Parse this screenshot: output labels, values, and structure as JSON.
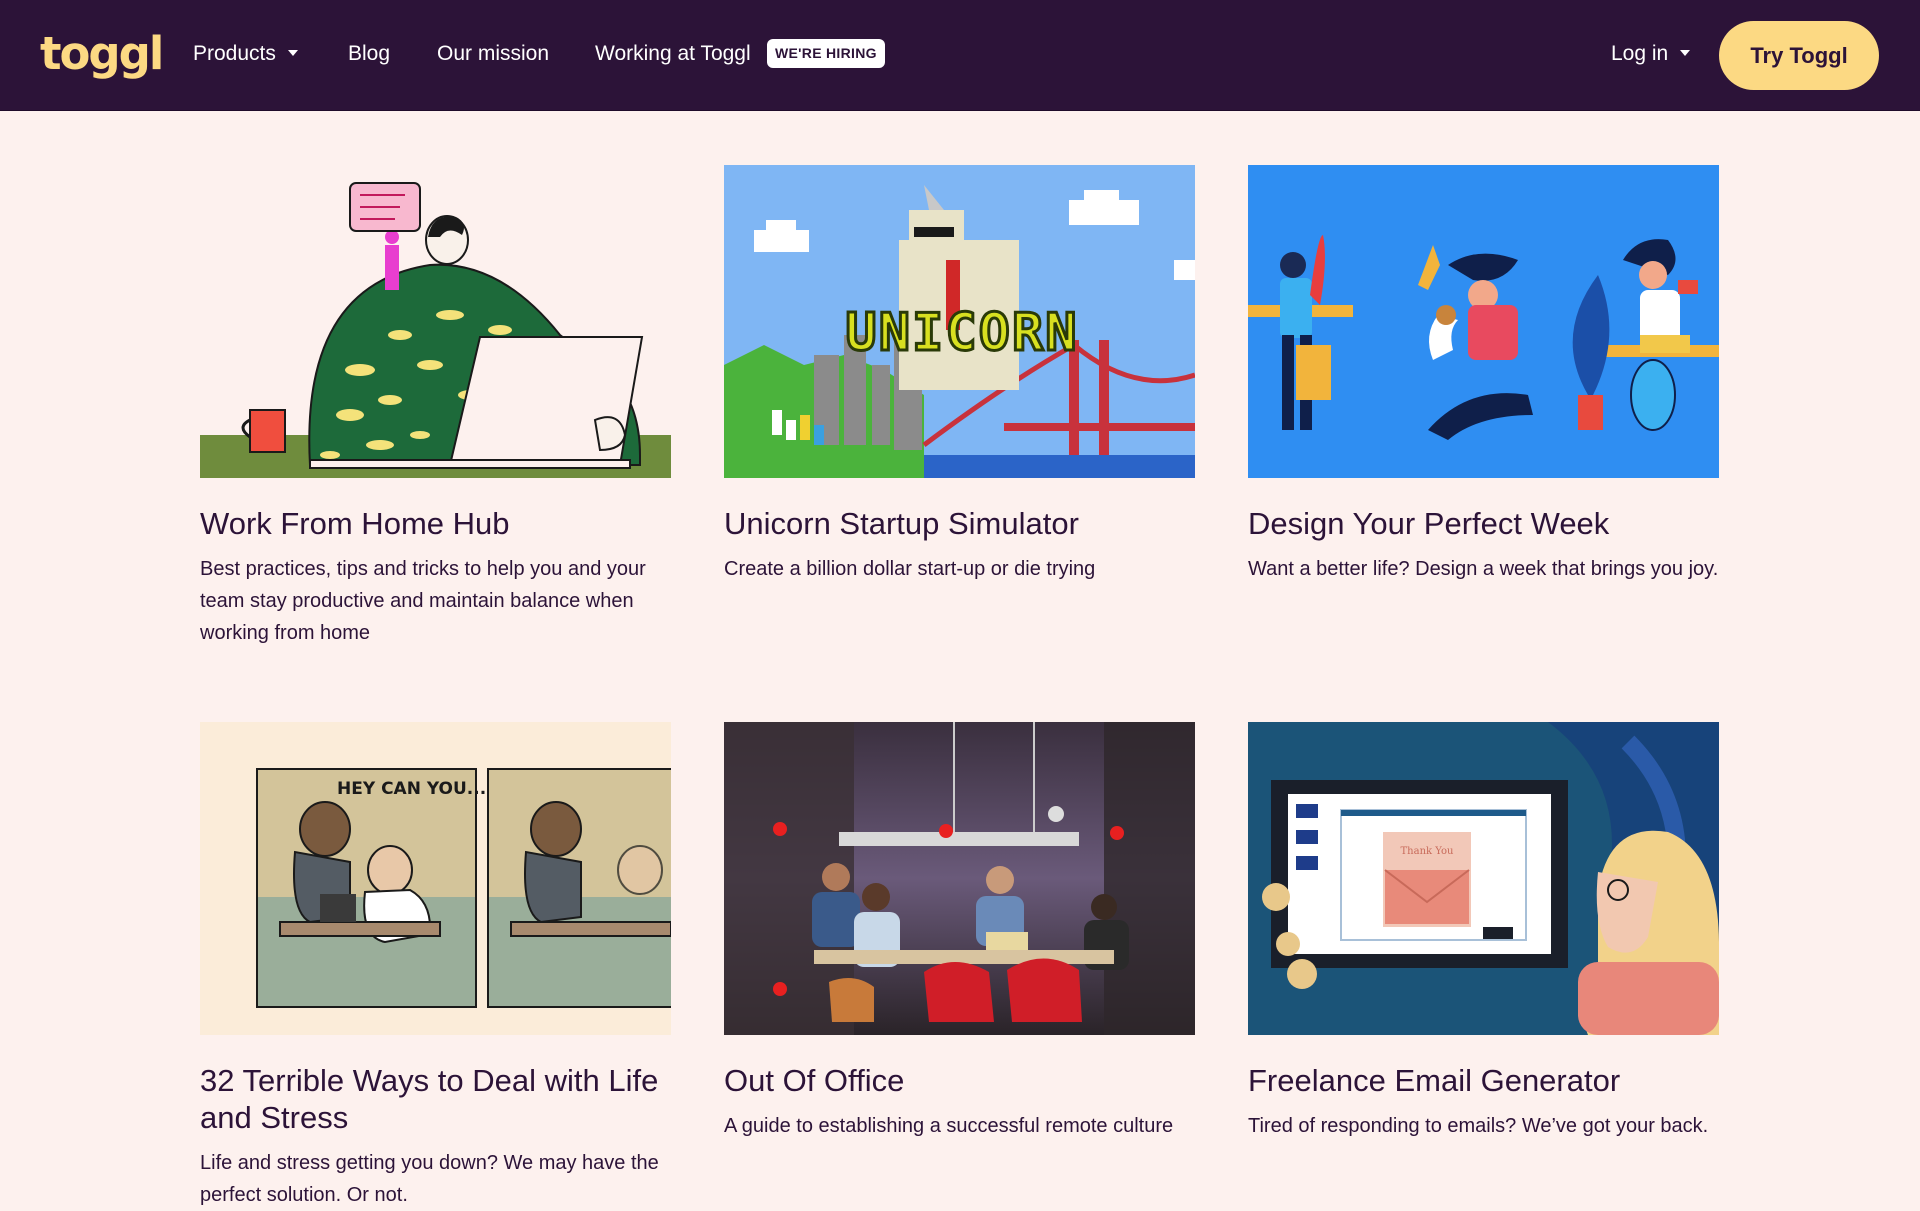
{
  "nav": {
    "logo": "toggl",
    "items": [
      {
        "label": "Products",
        "has_dropdown": true
      },
      {
        "label": "Blog",
        "has_dropdown": false
      },
      {
        "label": "Our mission",
        "has_dropdown": false
      },
      {
        "label": "Working at Toggl",
        "has_dropdown": false
      }
    ],
    "hiring_badge": "WE'RE HIRING",
    "login": "Log in",
    "cta": "Try Toggl",
    "colors": {
      "background": "#2c1338",
      "accent": "#fcd983"
    }
  },
  "cards": [
    {
      "title": "Work From Home Hub",
      "description": "Best practices, tips and tricks to help you and your team stay productive and maintain balance when working from home",
      "image": "wfh-illustration"
    },
    {
      "title": "Unicorn Startup Simulator",
      "description": "Create a billion dollar start-up or die trying",
      "image": "unicorn-pixel-art",
      "image_text": "UNICORN"
    },
    {
      "title": "Design Your Perfect Week",
      "description": "Want a better life? Design a week that brings you joy.",
      "image": "perfect-week-illustration"
    },
    {
      "title": "32 Terrible Ways to Deal with Life and Stress",
      "description": "Life and stress getting you down? We may have the perfect solution. Or not.",
      "image": "comic-strip",
      "image_text": "HEY CAN YOU..."
    },
    {
      "title": "Out Of Office",
      "description": "A guide to establishing a successful remote culture",
      "image": "office-meeting-photo"
    },
    {
      "title": "Freelance Email Generator",
      "description": "Tired of responding to emails? We’ve got your back.",
      "image": "email-illustration",
      "image_text": "Thank You"
    }
  ],
  "page": {
    "background": "#fdf1ee",
    "text_color": "#2c1338"
  }
}
